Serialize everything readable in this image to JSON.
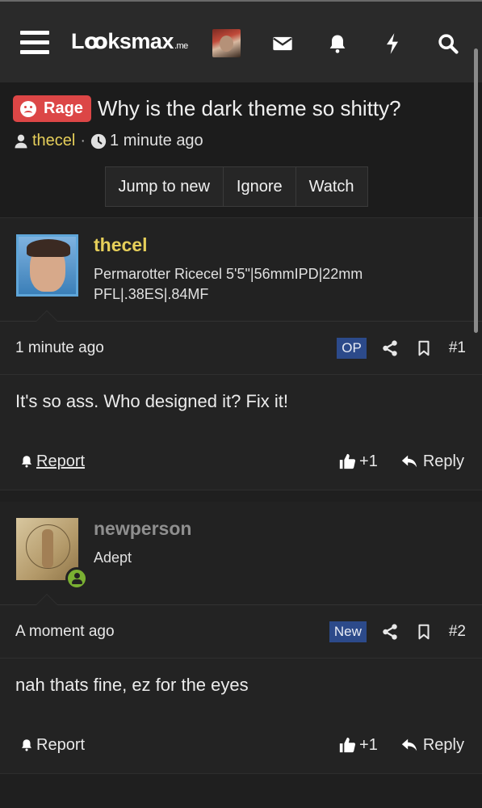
{
  "header": {
    "logo_text": "Lꝏksmax",
    "logo_suffix": ".me",
    "icons": [
      "menu-icon",
      "mail-icon",
      "bell-icon",
      "lightning-icon",
      "search-icon"
    ]
  },
  "thread": {
    "prefix": "Rage",
    "title": "Why is the dark theme so shitty?",
    "author": "thecel",
    "separator": "·",
    "time": "1 minute ago",
    "actions": [
      "Jump to new",
      "Ignore",
      "Watch"
    ]
  },
  "posts": [
    {
      "username": "thecel",
      "user_title": "Permarotter Ricecel 5'5\"|56mmIPD|22mm PFL|.38ES|.84MF",
      "time": "1 minute ago",
      "badge": "OP",
      "number": "#1",
      "body": "It's so ass. Who designed it? Fix it!",
      "report": "Report",
      "likes": "+1",
      "reply": "Reply"
    },
    {
      "username": "newperson",
      "user_title": "Adept",
      "time": "A moment ago",
      "badge": "New",
      "number": "#2",
      "body": "nah thats fine, ez for the eyes",
      "report": "Report",
      "likes": "+1",
      "reply": "Reply"
    }
  ],
  "colors": {
    "accent_gold": "#e6cf5a",
    "prefix_red": "#dc4646",
    "badge_blue": "#2c4a8a",
    "online_green": "#7ab032"
  }
}
